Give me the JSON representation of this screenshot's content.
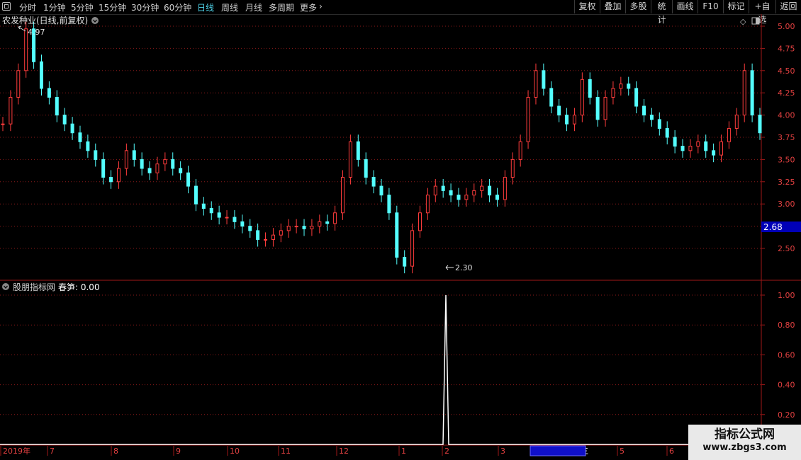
{
  "toolbar": {
    "periods": [
      "分时",
      "1分钟",
      "5分钟",
      "15分钟",
      "30分钟",
      "60分钟",
      "日线",
      "周线",
      "月线",
      "多周期",
      "更多"
    ],
    "active_period": "日线",
    "more_chevron": "›",
    "buttons": [
      "复权",
      "叠加",
      "多股",
      "统计",
      "画线",
      "F10",
      "标记",
      "+自选",
      "返回"
    ]
  },
  "main_panel": {
    "title": "农发种业(日线,前复权)",
    "high_marker": "4.97",
    "low_marker": "2.30",
    "price_tag": "2.68",
    "y_ticks": [
      "5.00",
      "4.75",
      "4.50",
      "4.25",
      "4.00",
      "3.75",
      "3.50",
      "3.25",
      "3.00",
      "2.75",
      "2.50"
    ]
  },
  "indicator_panel": {
    "title": "股朋指标网",
    "series_label": "春笋: 0.00",
    "y_ticks": [
      "1.00",
      "0.80",
      "0.60",
      "0.40",
      "0.20"
    ]
  },
  "x_axis": {
    "labels": [
      "2019年",
      "7",
      "8",
      "9",
      "10",
      "11",
      "12",
      "1",
      "2",
      "3",
      "2020/03/18/三",
      "5",
      "6"
    ]
  },
  "watermark": {
    "title": "指标公式网",
    "url": "www.zbgs3.com"
  },
  "colors": {
    "up": "#ff3c3c",
    "down": "#54ffff",
    "grid": "#8b1a1a",
    "accent_active": "#4fd2e8",
    "price_tag_bg": "#0000b8"
  },
  "chart_data": [
    {
      "type": "candlestick",
      "title": "农发种业(日线,前复权)",
      "y_range": [
        2.3,
        5.0
      ],
      "x_range": [
        "2019-06",
        "2020-06"
      ],
      "ohlc_approx": [
        3.9,
        4.2,
        4.5,
        4.97,
        4.6,
        4.3,
        4.2,
        4.0,
        3.9,
        3.8,
        3.7,
        3.6,
        3.5,
        3.3,
        3.25,
        3.4,
        3.6,
        3.5,
        3.4,
        3.35,
        3.45,
        3.5,
        3.4,
        3.35,
        3.2,
        3.0,
        2.95,
        2.9,
        2.85,
        2.85,
        2.8,
        2.75,
        2.7,
        2.6,
        2.6,
        2.65,
        2.7,
        2.75,
        2.75,
        2.72,
        2.75,
        2.8,
        2.78,
        2.9,
        3.3,
        3.7,
        3.5,
        3.3,
        3.2,
        3.1,
        2.9,
        2.4,
        2.3,
        2.7,
        2.9,
        3.1,
        3.2,
        3.15,
        3.1,
        3.05,
        3.1,
        3.15,
        3.2,
        3.1,
        3.05,
        3.3,
        3.5,
        3.7,
        4.2,
        4.5,
        4.3,
        4.1,
        4.0,
        3.9,
        4.0,
        4.4,
        4.2,
        3.95,
        4.2,
        4.3,
        4.35,
        4.3,
        4.1,
        4.0,
        3.95,
        3.85,
        3.75,
        3.65,
        3.6,
        3.65,
        3.7,
        3.6,
        3.55,
        3.7,
        3.85,
        4.0,
        4.5,
        4.0,
        3.8
      ],
      "extremes": {
        "high": 4.97,
        "low": 2.3
      },
      "last_price": 2.68
    },
    {
      "type": "line",
      "name": "春笋",
      "y_range": [
        0,
        1.0
      ],
      "spike_at": "2020-02",
      "spike_value": 1.0,
      "baseline": 0.0
    }
  ]
}
